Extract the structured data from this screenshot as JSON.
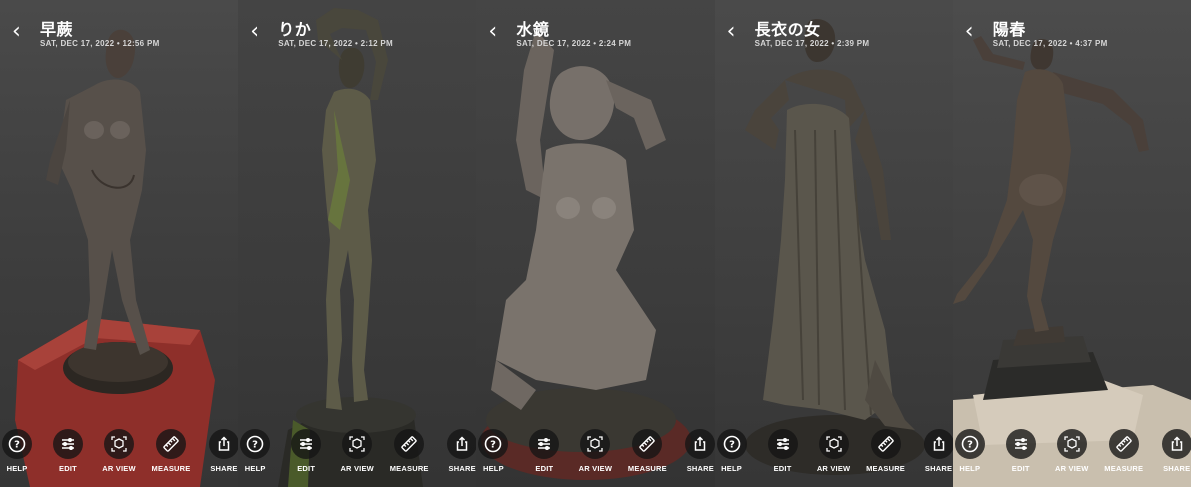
{
  "panels": [
    {
      "title": "早蕨",
      "meta": "SAT, DEC 17, 2022 • 12:56 PM"
    },
    {
      "title": "りか",
      "meta": "SAT, DEC 17, 2022 • 2:12 PM"
    },
    {
      "title": "水鏡",
      "meta": "SAT, DEC 17, 2022 • 2:24 PM"
    },
    {
      "title": "長衣の女",
      "meta": "SAT, DEC 17, 2022 • 2:39 PM"
    },
    {
      "title": "陽春",
      "meta": "SAT, DEC 17, 2022 • 4:37 PM"
    }
  ],
  "toolbar": {
    "help_label": "HELP",
    "edit_label": "EDIT",
    "ar_label": "AR VIEW",
    "measure_label": "MEASURE",
    "share_label": "SHARE"
  },
  "icons": {
    "back": "chevron-left-icon",
    "help": "question-circle-icon",
    "edit": "sliders-icon",
    "ar": "ar-cube-icon",
    "measure": "ruler-icon",
    "share": "share-icon"
  },
  "colors": {
    "background": "#3a3a3a",
    "text": "#ffffff",
    "button_bg": "#141414"
  }
}
